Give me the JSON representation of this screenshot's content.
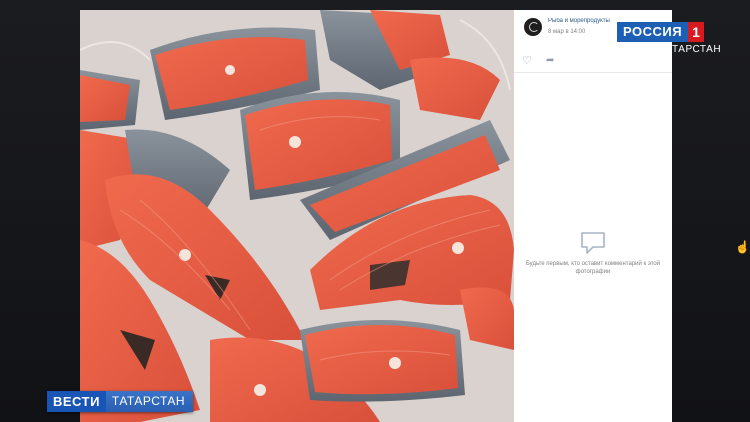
{
  "viewer": {
    "author": "Рыба и морепродукты",
    "date": "8 мар в 14:00",
    "empty_comments": "Будьте первым, кто оставит комментарий к этой фотографии"
  },
  "icons": {
    "like": "heart-icon",
    "share": "share-icon",
    "comments": "comment-bubble-icon",
    "cursor": "pointer-cursor-icon"
  },
  "broadcast": {
    "channel": "РОССИЯ",
    "channel_number": "1",
    "region_tag": "ТАРСТАН",
    "lower_third_left": "ВЕСТИ",
    "lower_third_right": "ТАТАРСТАН"
  },
  "colors": {
    "vk_link": "#2a5885",
    "channel_blue": "#1d5fb4",
    "channel_red": "#d71920"
  }
}
